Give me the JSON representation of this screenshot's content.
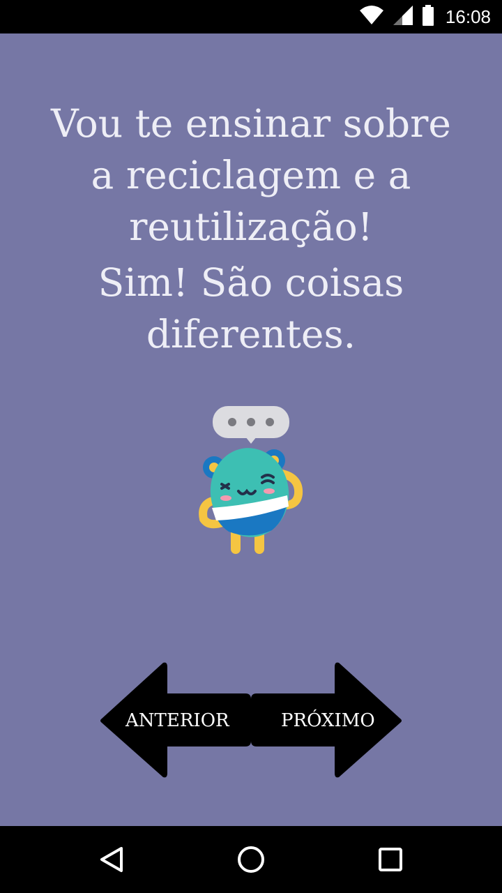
{
  "status_bar": {
    "time": "16:08",
    "icons": [
      "wifi-icon",
      "signal-icon",
      "battery-icon"
    ]
  },
  "message": {
    "paragraph1": [
      "Vou te ensinar sobre",
      "a reciclagem e a",
      "reutilização!"
    ],
    "paragraph2": [
      "Sim! São coisas",
      "diferentes."
    ]
  },
  "mascot": {
    "icon": "recycle-bin-mascot-icon",
    "speech_bubble_icon": "ellipsis-speech-bubble-icon"
  },
  "navigation": {
    "prev_label": "ANTERIOR",
    "next_label": "PRÓXIMO"
  },
  "system_nav": {
    "icons": [
      "back-icon",
      "home-icon",
      "recents-icon"
    ]
  },
  "colors": {
    "background": "#7677a5",
    "text": "#eeeef6",
    "arrow": "#000000",
    "mascot_body": "#3dbfb3",
    "mascot_band": "#1a78c2",
    "mascot_limbs": "#f5c542"
  }
}
